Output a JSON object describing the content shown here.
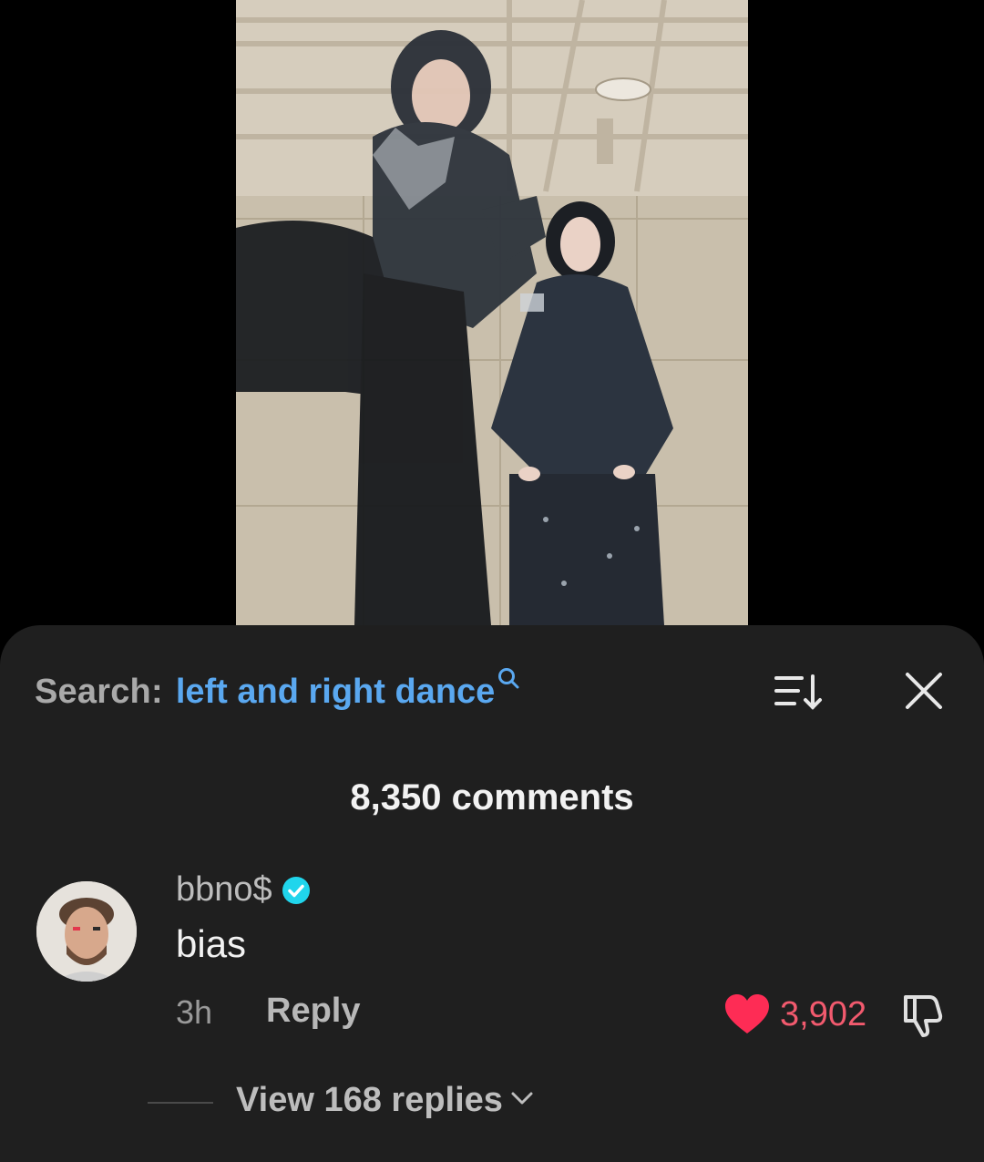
{
  "search": {
    "label": "Search:",
    "query": "left and right dance"
  },
  "comments": {
    "count_label": "8,350 comments"
  },
  "comment": {
    "username": "bbno$",
    "text": "bias",
    "time": "3h",
    "reply_label": "Reply",
    "likes": "3,902",
    "view_replies_label": "View 168 replies"
  },
  "colors": {
    "accent_blue": "#5aa8f0",
    "like_red": "#f25a6e",
    "sheet_bg": "#1f1f1f",
    "verified": "#20d5ec"
  },
  "icons": {
    "search": "search-icon",
    "sort": "sort-icon",
    "close": "close-icon",
    "verified": "verified-badge-icon",
    "heart": "heart-icon",
    "dislike": "dislike-icon",
    "chevron": "chevron-down-icon"
  }
}
